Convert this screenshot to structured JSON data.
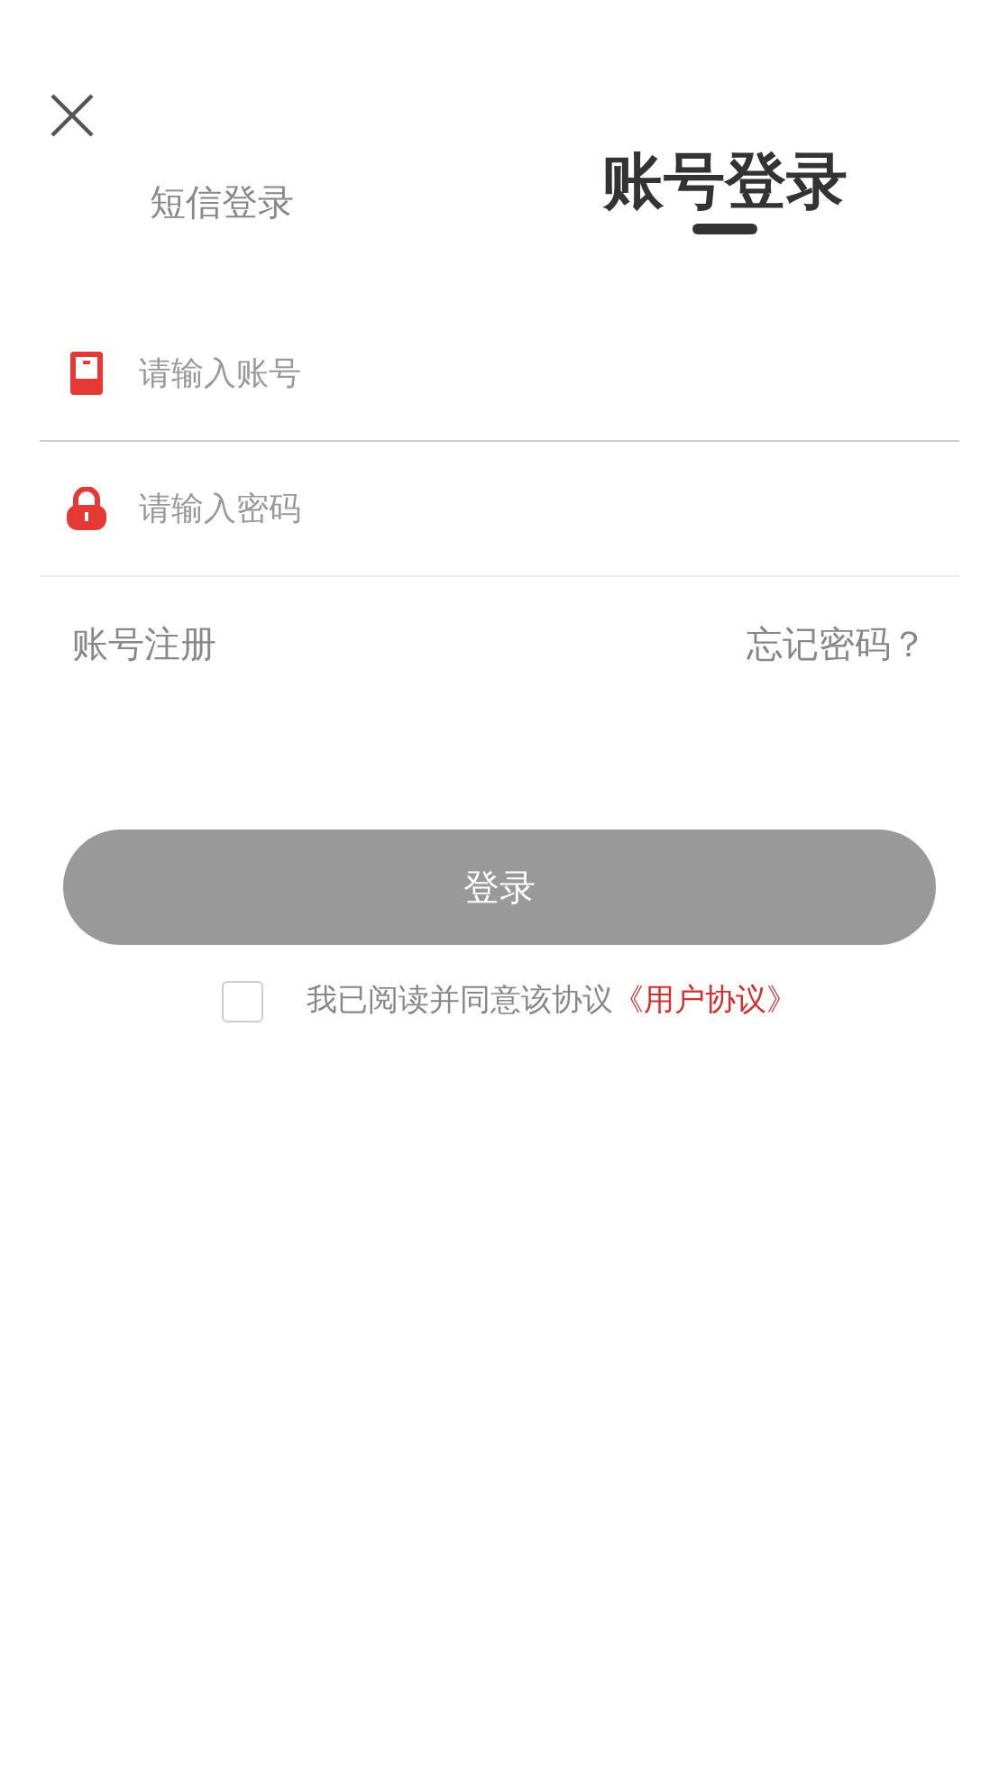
{
  "tabs": [
    {
      "label": "短信登录",
      "selected": false
    },
    {
      "label": "账号登录",
      "selected": true
    }
  ],
  "fields": [
    {
      "kind": "account",
      "placeholder": "请输入账号"
    },
    {
      "kind": "password",
      "placeholder": "请输入密码"
    }
  ],
  "links": {
    "register": "账号注册",
    "forgot": "忘记密码？"
  },
  "login_button": {
    "label": "登录",
    "disabled": true
  },
  "agreement": {
    "checked": false,
    "text": "我已阅读并同意该协议",
    "link": "《用户协议》"
  }
}
